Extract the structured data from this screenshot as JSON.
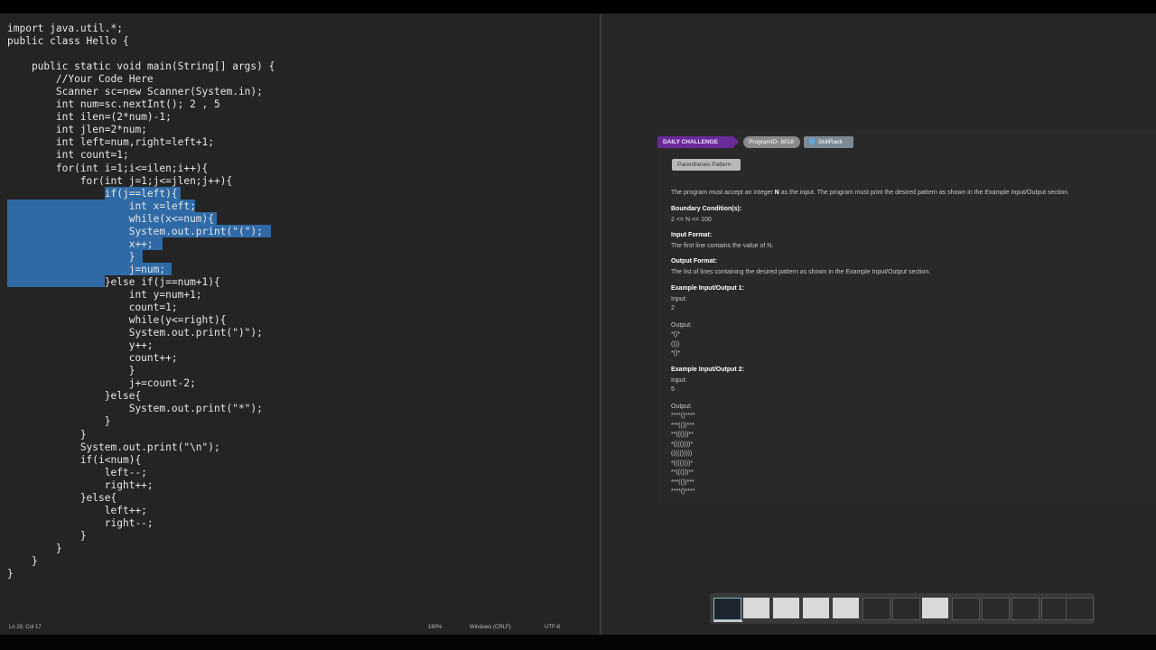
{
  "editor": {
    "code_lines": [
      "import java.util.*;",
      "public class Hello {",
      "",
      "    public static void main(String[] args) {",
      "        //Your Code Here",
      "        Scanner sc=new Scanner(System.in);",
      "        int num=sc.nextInt(); 2 , 5",
      "        int ilen=(2*num)-1;",
      "        int jlen=2*num;",
      "        int left=num,right=left+1;",
      "        int count=1;",
      "        for(int i=1;i<=ilen;i++){",
      "            for(int j=1;j<=jlen;j++){",
      "                if(j==left){",
      "                    int x=left;",
      "                    while(x<=num){",
      "                    System.out.print(\"(\");",
      "                    x++;",
      "                    }",
      "                    j=num;",
      "                }else if(j==num+1){",
      "                    int y=num+1;",
      "                    count=1;",
      "                    while(y<=right){",
      "                    System.out.print(\")\");",
      "                    y++;",
      "                    count++;",
      "                    }",
      "                    j+=count-2;",
      "                }else{",
      "                    System.out.print(\"*\");",
      "                }",
      "            }",
      "            System.out.print(\"\\n\");",
      "            if(i<num){",
      "                left--;",
      "                right++;",
      "            }else{",
      "                left++;",
      "                right--;",
      "            }",
      "        }",
      "    }",
      "}"
    ],
    "status": {
      "position": "Ln 29, Col 17",
      "zoom": "160%",
      "line_ending": "Windows (CRLF)",
      "encoding": "UTF-8"
    }
  },
  "problem": {
    "daily_label": "DAILY CHALLENGE",
    "program_id": "ProgramID- 8018",
    "skillrack": "SkillRack",
    "title": "Parentheses Pattern",
    "intro_a": "The program must accept an integer ",
    "intro_n": "N",
    "intro_b": " as the input. The program must print the desired pattern as shown in the Example Input/Output section.",
    "boundary_heading": "Boundary Condition(s):",
    "boundary_text": "2 <= N <= 100",
    "input_heading": "Input Format:",
    "input_text": "The first line contains the value of N.",
    "output_heading": "Output Format:",
    "output_text": "The list of lines containing the desired pattern as shown in the Example Input/Output section.",
    "ex1_heading": "Example Input/Output 1:",
    "ex1_input_label": "Input:",
    "ex1_input": "2",
    "ex1_output_label": "Output:",
    "ex1_output": "*()*\n(())\n*()*",
    "ex2_heading": "Example Input/Output 2:",
    "ex2_input_label": "Input:",
    "ex2_input": "5",
    "ex2_output_label": "Output:",
    "ex2_output": "****()****\n***(())***\n**((()))**\n*(((())))*\n((((()))))\n*(((())))*\n**((()))**\n***(())***\n****()****"
  }
}
